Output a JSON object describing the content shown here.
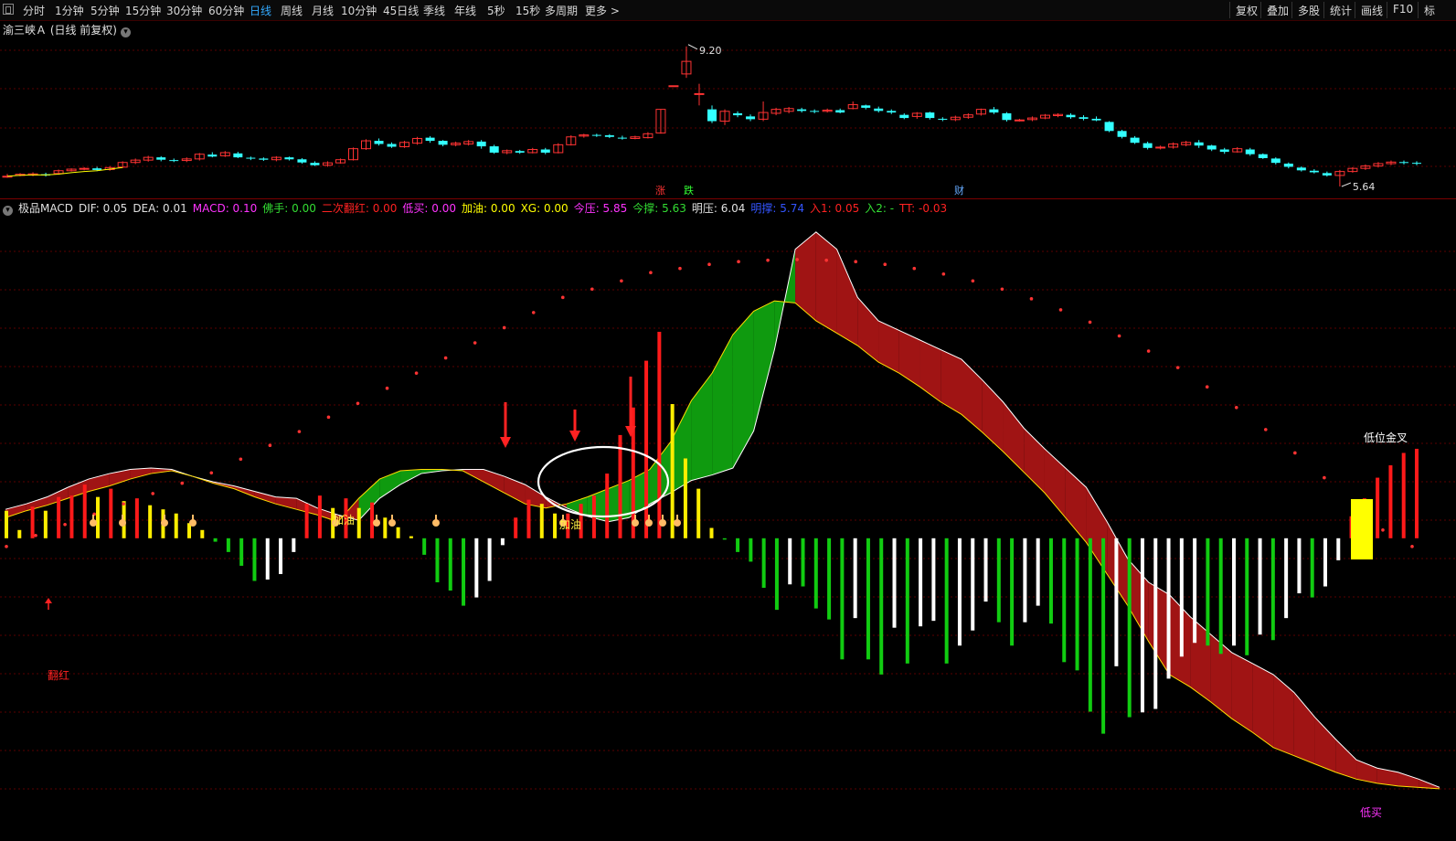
{
  "toolbar": {
    "periods": [
      "分时",
      "1分钟",
      "5分钟",
      "15分钟",
      "30分钟",
      "60分钟",
      "日线",
      "周线",
      "月线",
      "10分钟",
      "45日线",
      "季线",
      "年线",
      "5秒",
      "15秒",
      "多周期",
      "更多 >"
    ],
    "active_period": "日线",
    "right_buttons": [
      "复权",
      "叠加",
      "多股",
      "统计",
      "画线",
      "F10",
      "标"
    ]
  },
  "stock": {
    "title": "渝三峡Ａ (日线 前复权)"
  },
  "indicator": {
    "items": [
      {
        "label": "极品MACD",
        "color": "#e0e0e0"
      },
      {
        "label": "DIF: 0.05",
        "color": "#e0e0e0"
      },
      {
        "label": "DEA: 0.01",
        "color": "#e0e0e0"
      },
      {
        "label": "MACD: 0.10",
        "color": "#ff33ff"
      },
      {
        "label": "佛手: 0.00",
        "color": "#33dd33"
      },
      {
        "label": "二次翻红: 0.00",
        "color": "#ff2222"
      },
      {
        "label": "低买: 0.00",
        "color": "#ff33ff"
      },
      {
        "label": "加油: 0.00",
        "color": "#ffff00"
      },
      {
        "label": "XG: 0.00",
        "color": "#ffff00"
      },
      {
        "label": "今压: 5.85",
        "color": "#ff33ff"
      },
      {
        "label": "今撑: 5.63",
        "color": "#33dd33"
      },
      {
        "label": "明压: 6.04",
        "color": "#e0e0e0"
      },
      {
        "label": "明撑: 5.74",
        "color": "#3355ff"
      },
      {
        "label": "入1: 0.05",
        "color": "#ff2222"
      },
      {
        "label": "入2: -",
        "color": "#33dd33"
      },
      {
        "label": "TT: -0.03",
        "color": "#ff2222"
      }
    ]
  },
  "chart_data": [
    {
      "type": "candlestick",
      "title": "渝三峡Ａ (日线 前复权)",
      "max_label": "9.20",
      "min_label": "5.64",
      "markers": [
        {
          "text": "涨",
          "color": "#ff3333"
        },
        {
          "text": "跌",
          "color": "#33ff33"
        },
        {
          "text": "财",
          "color": "#66aaff"
        }
      ],
      "candles": [
        [
          5.9,
          5.9,
          5.96,
          5.86
        ],
        [
          5.92,
          5.95,
          5.98,
          5.9
        ],
        [
          5.93,
          5.96,
          6.0,
          5.9
        ],
        [
          5.95,
          5.92,
          5.99,
          5.89
        ],
        [
          5.97,
          6.04,
          6.07,
          5.94
        ],
        [
          6.04,
          6.08,
          6.1,
          6.02
        ],
        [
          6.08,
          6.1,
          6.13,
          6.05
        ],
        [
          6.1,
          6.06,
          6.14,
          6.03
        ],
        [
          6.07,
          6.12,
          6.16,
          6.04
        ],
        [
          6.13,
          6.25,
          6.28,
          6.11
        ],
        [
          6.25,
          6.31,
          6.35,
          6.21
        ],
        [
          6.31,
          6.38,
          6.42,
          6.27
        ],
        [
          6.38,
          6.32,
          6.41,
          6.28
        ],
        [
          6.31,
          6.3,
          6.35,
          6.26
        ],
        [
          6.3,
          6.34,
          6.38,
          6.26
        ],
        [
          6.34,
          6.46,
          6.49,
          6.3
        ],
        [
          6.45,
          6.4,
          6.51,
          6.38
        ],
        [
          6.42,
          6.5,
          6.54,
          6.39
        ],
        [
          6.48,
          6.38,
          6.52,
          6.36
        ],
        [
          6.37,
          6.35,
          6.4,
          6.31
        ],
        [
          6.35,
          6.32,
          6.38,
          6.29
        ],
        [
          6.32,
          6.38,
          6.41,
          6.28
        ],
        [
          6.38,
          6.33,
          6.4,
          6.3
        ],
        [
          6.33,
          6.25,
          6.36,
          6.22
        ],
        [
          6.24,
          6.18,
          6.28,
          6.16
        ],
        [
          6.18,
          6.24,
          6.28,
          6.14
        ],
        [
          6.24,
          6.32,
          6.35,
          6.22
        ],
        [
          6.32,
          6.6,
          6.63,
          6.3
        ],
        [
          6.6,
          6.8,
          6.84,
          6.57
        ],
        [
          6.8,
          6.72,
          6.86,
          6.68
        ],
        [
          6.72,
          6.65,
          6.76,
          6.62
        ],
        [
          6.65,
          6.76,
          6.8,
          6.62
        ],
        [
          6.74,
          6.86,
          6.9,
          6.7
        ],
        [
          6.88,
          6.8,
          6.92,
          6.75
        ],
        [
          6.8,
          6.7,
          6.82,
          6.66
        ],
        [
          6.7,
          6.74,
          6.78,
          6.66
        ],
        [
          6.72,
          6.78,
          6.82,
          6.68
        ],
        [
          6.78,
          6.66,
          6.82,
          6.6
        ],
        [
          6.66,
          6.5,
          6.7,
          6.47
        ],
        [
          6.5,
          6.55,
          6.58,
          6.46
        ],
        [
          6.54,
          6.5,
          6.57,
          6.47
        ],
        [
          6.5,
          6.58,
          6.62,
          6.48
        ],
        [
          6.58,
          6.5,
          6.62,
          6.46
        ],
        [
          6.5,
          6.7,
          6.74,
          6.48
        ],
        [
          6.7,
          6.9,
          6.94,
          6.68
        ],
        [
          6.92,
          6.95,
          6.98,
          6.88
        ],
        [
          6.95,
          6.94,
          6.98,
          6.9
        ],
        [
          6.94,
          6.9,
          6.97,
          6.87
        ],
        [
          6.88,
          6.86,
          6.93,
          6.83
        ],
        [
          6.86,
          6.9,
          6.93,
          6.84
        ],
        [
          6.88,
          6.98,
          7.02,
          6.86
        ],
        [
          7.0,
          7.6,
          7.6,
          6.98
        ],
        [
          8.2,
          8.2,
          8.2,
          8.2
        ],
        [
          8.5,
          8.82,
          9.2,
          8.4
        ],
        [
          8.0,
          8.0,
          8.25,
          7.7
        ],
        [
          7.6,
          7.3,
          7.7,
          7.25
        ],
        [
          7.3,
          7.55,
          7.6,
          7.2
        ],
        [
          7.5,
          7.45,
          7.55,
          7.4
        ],
        [
          7.42,
          7.35,
          7.47,
          7.3
        ],
        [
          7.35,
          7.52,
          7.8,
          7.3
        ],
        [
          7.5,
          7.6,
          7.64,
          7.45
        ],
        [
          7.55,
          7.62,
          7.66,
          7.5
        ],
        [
          7.6,
          7.56,
          7.64,
          7.52
        ],
        [
          7.56,
          7.55,
          7.6,
          7.5
        ],
        [
          7.55,
          7.58,
          7.62,
          7.52
        ],
        [
          7.58,
          7.52,
          7.62,
          7.5
        ],
        [
          7.62,
          7.72,
          7.8,
          7.6
        ],
        [
          7.7,
          7.64,
          7.72,
          7.6
        ],
        [
          7.62,
          7.56,
          7.67,
          7.52
        ],
        [
          7.56,
          7.52,
          7.6,
          7.48
        ],
        [
          7.46,
          7.38,
          7.5,
          7.35
        ],
        [
          7.42,
          7.5,
          7.53,
          7.36
        ],
        [
          7.52,
          7.38,
          7.54,
          7.34
        ],
        [
          7.36,
          7.34,
          7.4,
          7.3
        ],
        [
          7.34,
          7.4,
          7.44,
          7.3
        ],
        [
          7.4,
          7.46,
          7.5,
          7.36
        ],
        [
          7.48,
          7.6,
          7.62,
          7.44
        ],
        [
          7.6,
          7.52,
          7.66,
          7.48
        ],
        [
          7.5,
          7.33,
          7.53,
          7.29
        ],
        [
          7.32,
          7.33,
          7.36,
          7.29
        ],
        [
          7.34,
          7.38,
          7.42,
          7.3
        ],
        [
          7.38,
          7.45,
          7.48,
          7.35
        ],
        [
          7.44,
          7.47,
          7.5,
          7.4
        ],
        [
          7.46,
          7.4,
          7.5,
          7.36
        ],
        [
          7.4,
          7.36,
          7.45,
          7.32
        ],
        [
          7.36,
          7.32,
          7.42,
          7.3
        ],
        [
          7.28,
          7.05,
          7.3,
          7.02
        ],
        [
          7.05,
          6.9,
          7.08,
          6.86
        ],
        [
          6.88,
          6.75,
          6.92,
          6.72
        ],
        [
          6.74,
          6.62,
          6.78,
          6.58
        ],
        [
          6.62,
          6.64,
          6.68,
          6.58
        ],
        [
          6.64,
          6.72,
          6.76,
          6.6
        ],
        [
          6.7,
          6.76,
          6.8,
          6.66
        ],
        [
          6.76,
          6.68,
          6.82,
          6.62
        ],
        [
          6.68,
          6.58,
          6.7,
          6.54
        ],
        [
          6.58,
          6.52,
          6.62,
          6.47
        ],
        [
          6.52,
          6.6,
          6.64,
          6.5
        ],
        [
          6.58,
          6.46,
          6.62,
          6.42
        ],
        [
          6.46,
          6.36,
          6.48,
          6.34
        ],
        [
          6.35,
          6.24,
          6.38,
          6.2
        ],
        [
          6.22,
          6.14,
          6.25,
          6.1
        ],
        [
          6.12,
          6.05,
          6.15,
          6.02
        ],
        [
          6.04,
          6.0,
          6.08,
          5.97
        ],
        [
          5.98,
          5.92,
          6.02,
          5.89
        ],
        [
          5.92,
          6.02,
          6.06,
          5.64
        ],
        [
          6.02,
          6.1,
          6.13,
          5.99
        ],
        [
          6.1,
          6.16,
          6.2,
          6.06
        ],
        [
          6.16,
          6.22,
          6.26,
          6.12
        ],
        [
          6.22,
          6.26,
          6.3,
          6.18
        ],
        [
          6.26,
          6.24,
          6.3,
          6.2
        ],
        [
          6.24,
          6.22,
          6.28,
          6.18
        ]
      ],
      "ylim": [
        5.5,
        9.45
      ]
    },
    {
      "type": "macd",
      "title": "极品MACD",
      "annotations": [
        {
          "text": "翻红",
          "color": "#ff2222"
        },
        {
          "text": "加油",
          "color": "#ffee44"
        },
        {
          "text": "加油",
          "color": "#ffee44"
        },
        {
          "text": "低位金叉",
          "color": "#ffffff"
        },
        {
          "text": "低买",
          "color": "#ff33ff"
        }
      ],
      "hist": [
        0.4,
        0.12,
        0.46,
        0.4,
        0.6,
        0.62,
        0.78,
        0.6,
        0.72,
        0.54,
        0.58,
        0.48,
        0.42,
        0.36,
        0.22,
        0.12,
        -0.05,
        -0.2,
        -0.4,
        -0.62,
        -0.6,
        -0.52,
        -0.2,
        0.5,
        0.62,
        0.44,
        0.58,
        0.44,
        0.52,
        0.3,
        0.16,
        0.03,
        -0.24,
        -0.64,
        -0.76,
        -0.98,
        -0.86,
        -0.62,
        -0.1,
        0.3,
        0.56,
        0.5,
        0.36,
        0.36,
        0.5,
        0.62,
        0.94,
        1.5,
        1.9,
        2.58,
        3.0,
        1.95,
        1.16,
        0.72,
        0.15,
        -0.02,
        -0.2,
        -0.34,
        -0.72,
        -1.04,
        -0.67,
        -0.7,
        -1.02,
        -1.18,
        -1.76,
        -1.16,
        -1.76,
        -1.98,
        -1.3,
        -1.82,
        -1.28,
        -1.2,
        -1.82,
        -1.56,
        -1.34,
        -0.92,
        -1.22,
        -1.56,
        -1.22,
        -0.98,
        -1.24,
        -1.8,
        -1.92,
        -2.52,
        -2.84,
        -1.86,
        -2.6,
        -2.53,
        -2.48,
        -2.04,
        -1.72,
        -1.52,
        -1.56,
        -1.68,
        -1.56,
        -1.7,
        -1.4,
        -1.48,
        -1.16,
        -0.8,
        -0.86,
        -0.7,
        -0.32,
        0.32,
        0.58,
        0.88,
        1.06,
        1.24,
        1.3
      ],
      "dif": [
        0.42,
        0.5,
        0.6,
        0.74,
        0.86,
        0.94,
        1.0,
        1.02,
        1.0,
        0.9,
        0.82,
        0.76,
        0.68,
        0.6,
        0.58,
        0.44,
        0.34,
        0.26,
        0.58,
        0.78,
        0.94,
        0.98,
        1.0,
        1.0,
        0.9,
        0.78,
        0.6,
        0.44,
        0.32,
        0.24,
        0.3,
        0.5,
        0.66,
        0.84,
        0.92,
        1.02,
        1.56,
        2.74,
        4.2,
        4.45,
        4.2,
        3.5,
        3.16,
        3.02,
        2.88,
        2.74,
        2.6,
        2.3,
        1.98,
        1.6,
        1.3,
        1.02,
        0.74,
        0.24,
        -0.3,
        -0.64,
        -0.82,
        -1.14,
        -1.4,
        -1.66,
        -1.82,
        -1.98,
        -2.24,
        -2.6,
        -2.92,
        -3.22,
        -3.34,
        -3.4,
        -3.5,
        -3.62
      ],
      "dea": [
        0.3,
        0.4,
        0.48,
        0.58,
        0.68,
        0.76,
        0.86,
        0.94,
        0.98,
        0.9,
        0.8,
        0.72,
        0.6,
        0.5,
        0.42,
        0.34,
        0.24,
        0.58,
        0.86,
        0.98,
        1.0,
        1.0,
        0.98,
        0.82,
        0.66,
        0.5,
        0.44,
        0.5,
        0.6,
        0.72,
        0.84,
        1.0,
        1.4,
        2.0,
        2.4,
        2.96,
        3.3,
        3.45,
        3.42,
        3.16,
        2.98,
        2.8,
        2.56,
        2.4,
        2.2,
        1.98,
        1.8,
        1.54,
        1.26,
        0.96,
        0.66,
        0.3,
        -0.06,
        -0.52,
        -0.98,
        -1.5,
        -1.98,
        -2.16,
        -2.38,
        -2.62,
        -2.82,
        -3.04,
        -3.16,
        -3.28,
        -3.4,
        -3.5,
        -3.56,
        -3.6,
        -3.62,
        -3.64
      ],
      "signal_dots": [
        -0.12,
        0.04,
        0.2,
        0.35,
        0.5,
        0.65,
        0.8,
        0.95,
        1.15,
        1.35,
        1.55,
        1.76,
        1.96,
        2.18,
        2.4,
        2.62,
        2.84,
        3.06,
        3.28,
        3.5,
        3.62,
        3.74,
        3.86,
        3.92,
        3.98,
        4.02,
        4.04,
        4.05,
        4.04,
        4.02,
        3.98,
        3.92,
        3.84,
        3.74,
        3.62,
        3.48,
        3.32,
        3.14,
        2.94,
        2.72,
        2.48,
        2.2,
        1.9,
        1.58,
        1.24,
        0.88,
        0.5,
        0.12,
        -0.12
      ],
      "ylim": [
        -4.2,
        4.7
      ]
    }
  ]
}
